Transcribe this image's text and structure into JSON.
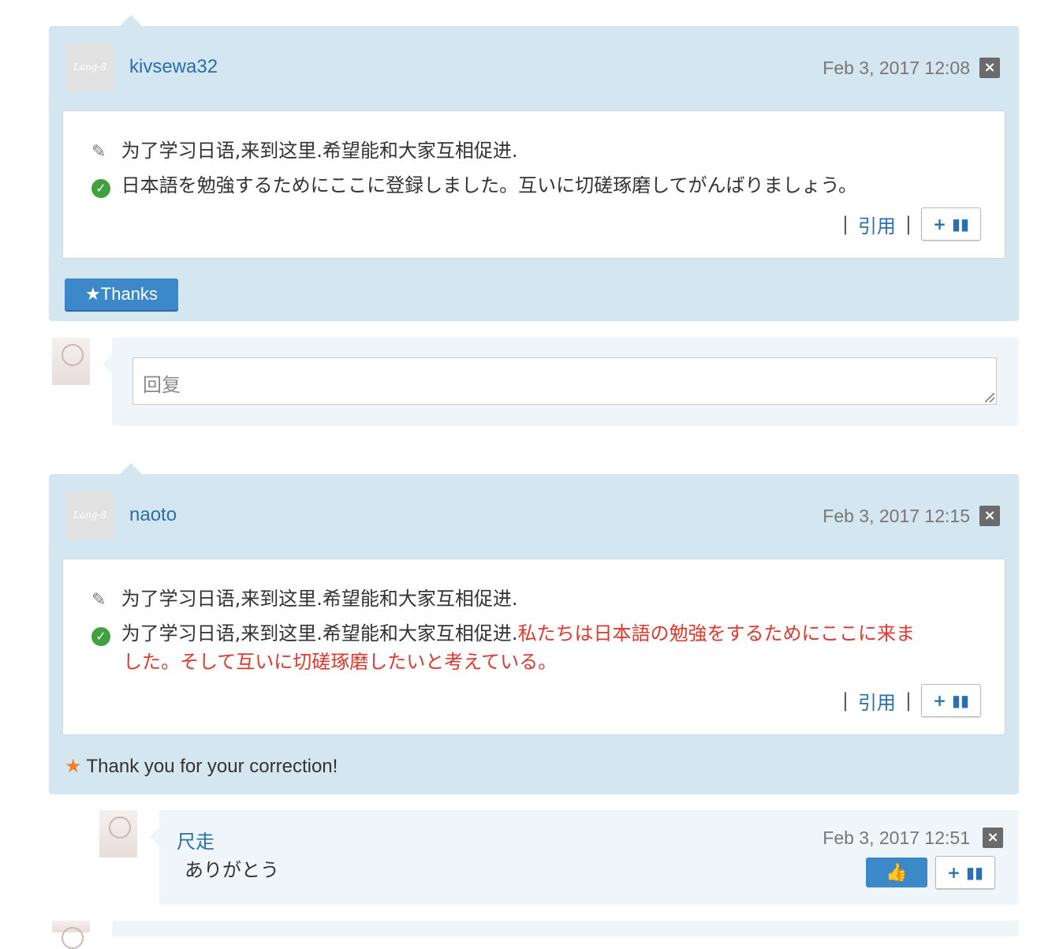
{
  "corrections": [
    {
      "username": "kivsewa32",
      "avatar_text": "Lang-8",
      "timestamp": "Feb 3, 2017 12:08",
      "original": "为了学习日语,来到这里.希望能和大家互相促进.",
      "corrected_plain": "日本語を勉強するためにここに登録しました。互いに切磋琢磨してがんばりましょう。",
      "quote_label": "引用",
      "separator": "|",
      "book_label": "+ ▮▮",
      "thanks_label": "Thanks"
    },
    {
      "username": "naoto",
      "avatar_text": "Lang-8",
      "timestamp": "Feb 3, 2017 12:15",
      "original": "为了学习日语,来到这里.希望能和大家互相促进.",
      "corrected_plain": "为了学习日语,来到这里.希望能和大家互相促进.",
      "corrected_red_1": "私たちは日本語の勉強をするためにここに来ま",
      "corrected_red_2": "した。そして互いに切磋琢磨したいと考えている。",
      "quote_label": "引用",
      "separator": "|",
      "book_label": "+ ▮▮",
      "thanks_note": "Thank you for your correction!"
    }
  ],
  "reply": {
    "placeholder": "回复"
  },
  "comment": {
    "username": "尺走",
    "text": "ありがとう",
    "timestamp": "Feb 3, 2017 12:51",
    "like_icon": "thumbs-up-icon",
    "book_label": "+ ▮▮"
  },
  "icons": {
    "close": "×",
    "pencil": "✎",
    "check": "✓",
    "star": "★",
    "thumb": "👍"
  },
  "colors": {
    "card_bg": "#d4e6ef",
    "link": "#2a6fb0",
    "correction_red": "#e0382e",
    "button_blue": "#3d88c8",
    "check_green": "#3fa13f",
    "star_orange": "#f07f2c"
  }
}
